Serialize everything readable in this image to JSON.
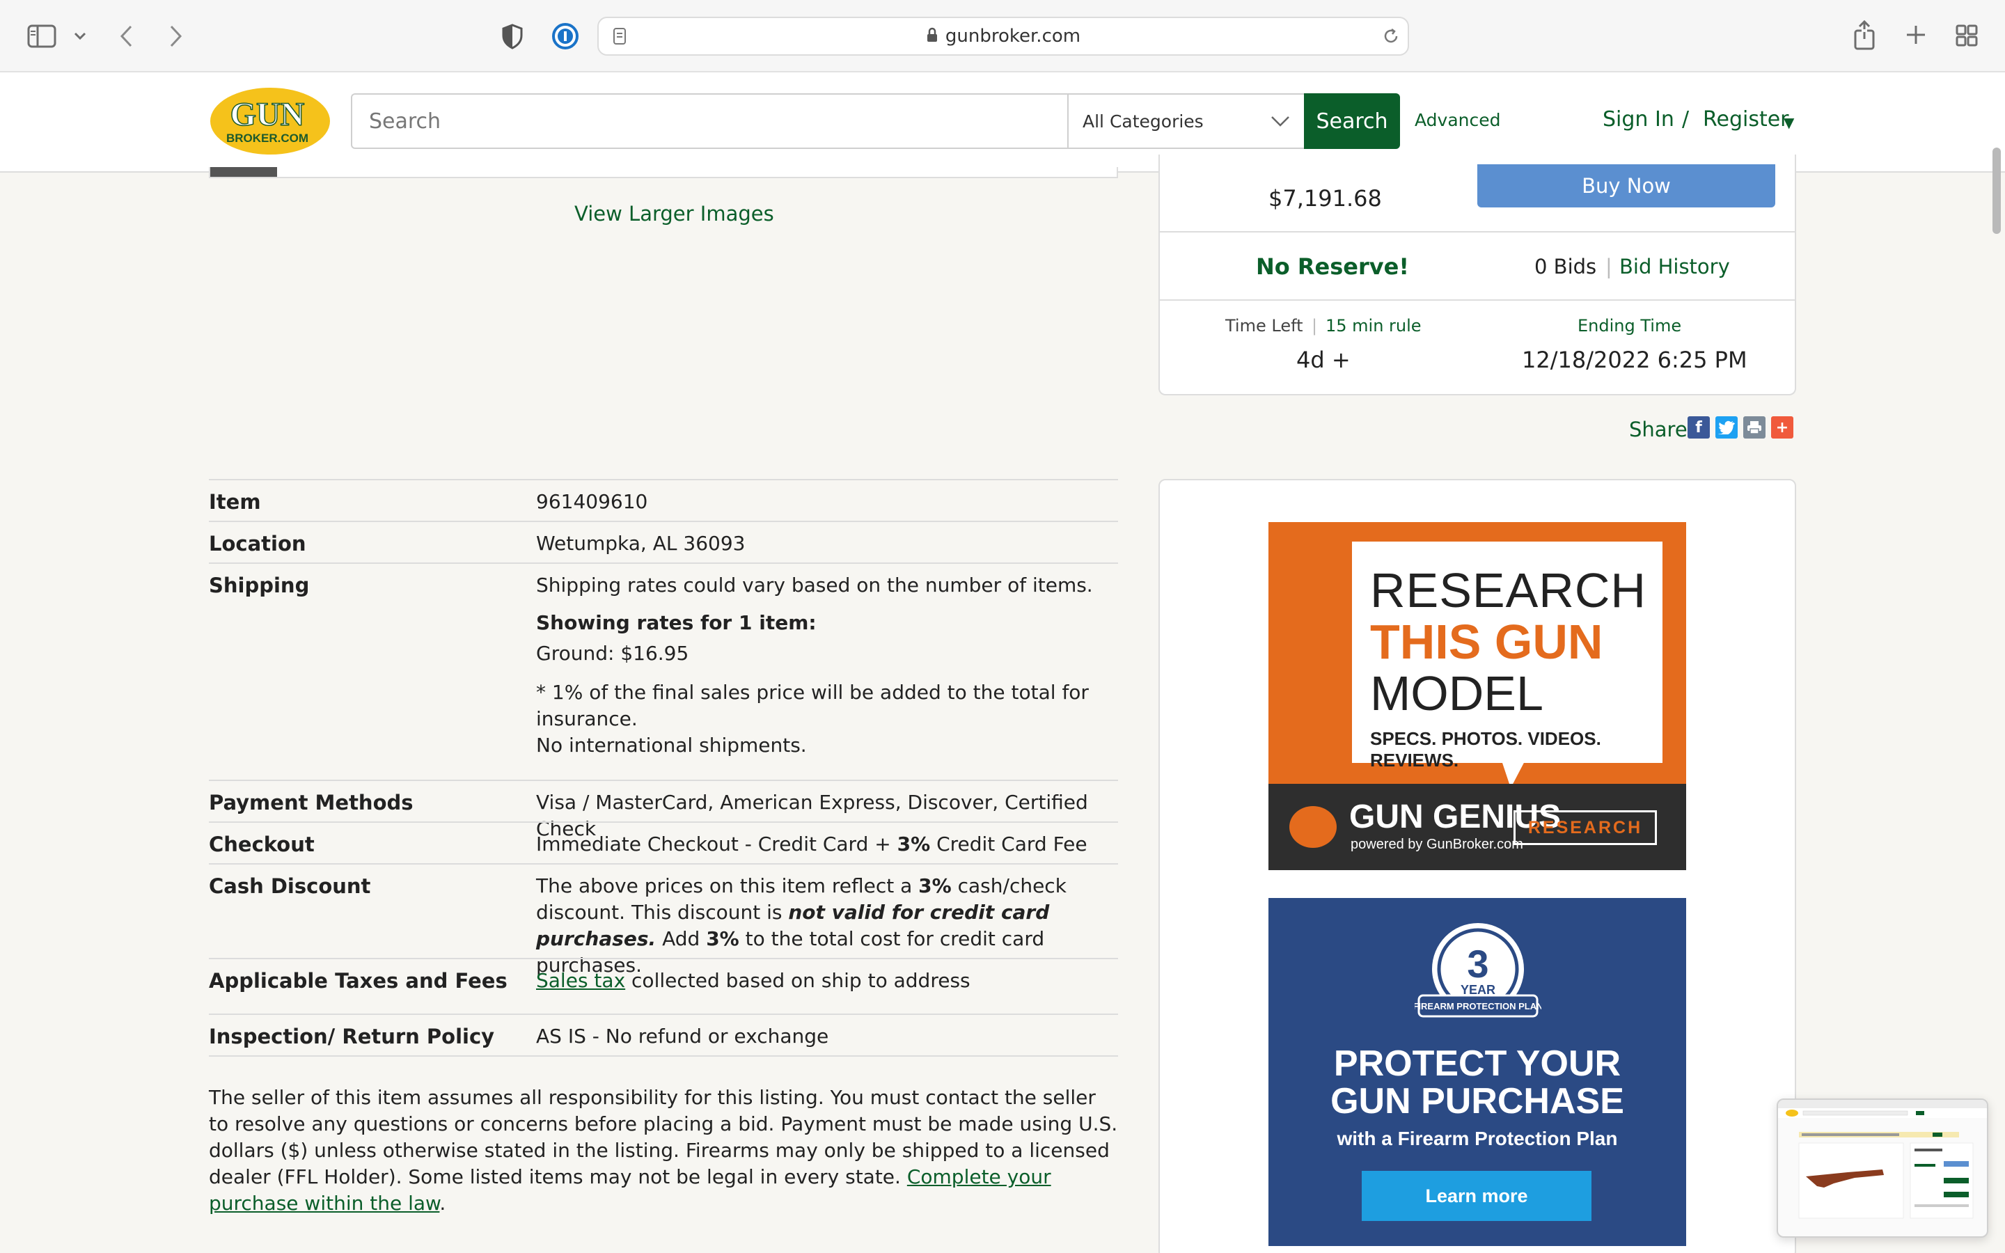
{
  "browser": {
    "url": "gunbroker.com"
  },
  "header": {
    "logo_top": "GUN",
    "logo_bottom": "BROKER.COM",
    "search_placeholder": "Search",
    "category": "All Categories",
    "search_button": "Search",
    "advanced": "Advanced",
    "sign_in": "Sign In",
    "separator": "/",
    "register": "Register"
  },
  "gallery": {
    "view_larger": "View Larger Images"
  },
  "buybox": {
    "price": "$7,191.68",
    "buy_now": "Buy Now",
    "no_reserve": "No Reserve!",
    "bids": "0 Bids",
    "bid_history": "Bid History",
    "time_left_label": "Time Left",
    "fifteen_min_rule": "15 min rule",
    "ending_time_label": "Ending Time",
    "time_left_value": "4d +",
    "ending_time_value": "12/18/2022 6:25 PM"
  },
  "share": {
    "label": "Share"
  },
  "details": {
    "item_label": "Item",
    "item_value": "961409610",
    "location_label": "Location",
    "location_value": "Wetumpka, AL 36093",
    "shipping_label": "Shipping",
    "shipping_line1": "Shipping rates could vary based on the number of items.",
    "shipping_line2": "Showing rates for 1 item:",
    "shipping_line3": "Ground: $16.95",
    "shipping_line4": "* 1% of the final sales price will be added to the total for insurance.",
    "shipping_line5": "No international shipments.",
    "payment_label": "Payment Methods",
    "payment_value": "Visa / MasterCard, American Express, Discover, Certified Check",
    "checkout_label": "Checkout",
    "checkout_pre": "Immediate Checkout - Credit Card + ",
    "checkout_pct": "3%",
    "checkout_post": " Credit Card Fee",
    "cash_label": "Cash Discount",
    "cash_a": "The above prices on this item reflect a ",
    "cash_pct1": "3%",
    "cash_b": " cash/check discount. This discount is ",
    "cash_italic": "not valid for credit card purchases.",
    "cash_c": " Add ",
    "cash_pct2": "3%",
    "cash_d": " to the total cost for credit card purchases.",
    "taxes_label": "Applicable Taxes and Fees",
    "taxes_link": "Sales tax",
    "taxes_value": " collected based on ship to address",
    "inspection_label": "Inspection/ Return Policy",
    "inspection_value": "AS IS - No refund or exchange"
  },
  "disclaimer": {
    "text": "The seller of this item assumes all responsibility for this listing. You must contact the seller to resolve any questions or concerns before placing a bid. Payment must be made using U.S. dollars ($) unless otherwise stated in the listing. Firearms may only be shipped to a licensed dealer (FFL Holder). Some listed items may not be legal in every state. ",
    "link": "Complete your purchase within the law",
    "end": "."
  },
  "ads": {
    "ad1_line1": "RESEARCH",
    "ad1_line2": "THIS GUN",
    "ad1_line3": "MODEL",
    "ad1_line4": "SPECS. PHOTOS. VIDEOS. REVIEWS.",
    "ad1_brand": "GUN GENIUS",
    "ad1_powered": "powered by GunBroker.com",
    "ad1_button": "RESEARCH",
    "ad2_badge_num": "3",
    "ad2_badge_year": "YEAR",
    "ad2_badge_text": "FIREARM PROTECTION PLAN",
    "ad2_line1": "PROTECT YOUR",
    "ad2_line2": "GUN PURCHASE",
    "ad2_line3": "with a Firearm Protection Plan",
    "ad2_button": "Learn more"
  },
  "colors": {
    "brand_green": "#0b5e2a",
    "logo_yellow": "#f5c21b",
    "buy_now_blue": "#5b8fd0",
    "ad_orange": "#e46b1d",
    "ad_navy": "#2b4a84"
  }
}
